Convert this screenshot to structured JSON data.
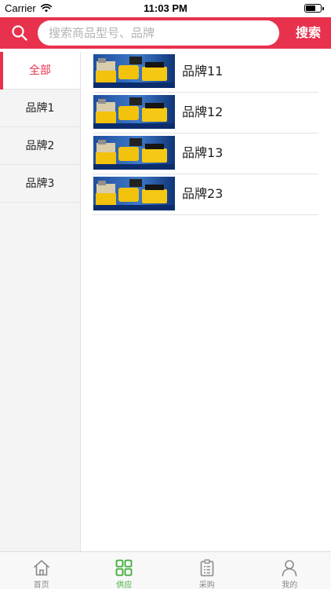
{
  "status_bar": {
    "carrier": "Carrier",
    "time": "11:03 PM"
  },
  "search": {
    "placeholder": "搜索商品型号、品牌",
    "value": "",
    "button_label": "搜索"
  },
  "sidebar": {
    "items": [
      {
        "label": "全部",
        "active": true
      },
      {
        "label": "品牌1",
        "active": false
      },
      {
        "label": "品牌2",
        "active": false
      },
      {
        "label": "品牌3",
        "active": false
      }
    ]
  },
  "products": [
    {
      "name": "品牌11"
    },
    {
      "name": "品牌12"
    },
    {
      "name": "品牌13"
    },
    {
      "name": "品牌23"
    }
  ],
  "tab_bar": {
    "tabs": [
      {
        "label": "首页",
        "icon": "home-icon",
        "active": false
      },
      {
        "label": "供应",
        "icon": "grid-icon",
        "active": true
      },
      {
        "label": "采购",
        "icon": "clipboard-icon",
        "active": false
      },
      {
        "label": "我的",
        "icon": "user-icon",
        "active": false
      }
    ]
  },
  "colors": {
    "accent": "#e8324d",
    "tab_active": "#3cac36",
    "tab_inactive": "#8a8a8a",
    "sidebar_bg": "#f4f4f4"
  }
}
